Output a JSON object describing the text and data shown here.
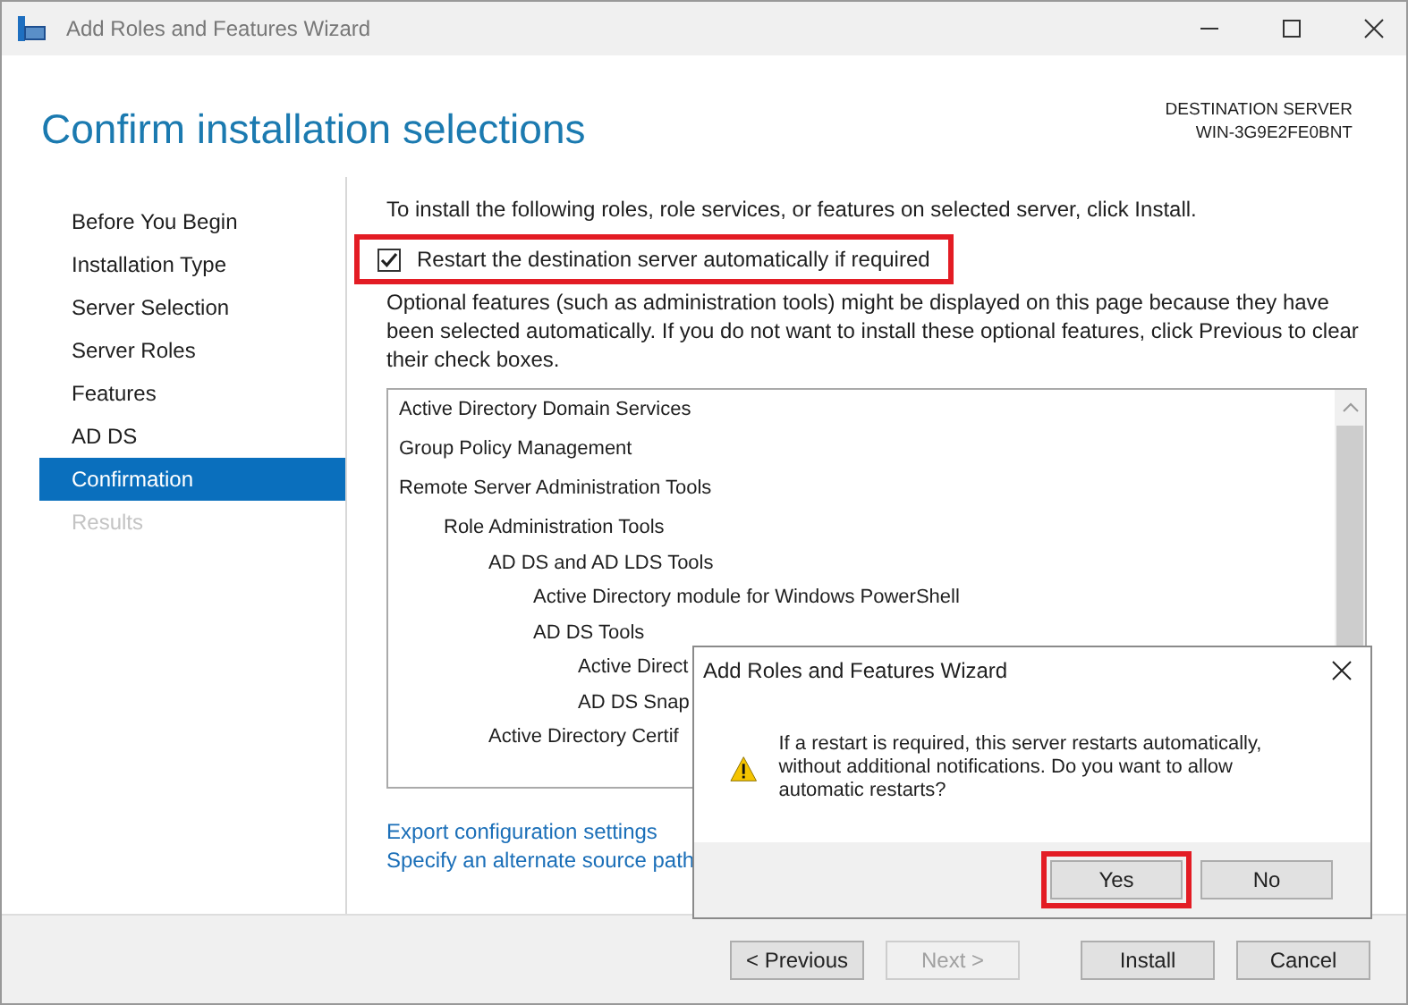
{
  "window": {
    "title": "Add Roles and Features Wizard"
  },
  "header": {
    "title": "Confirm installation selections",
    "server_label": "DESTINATION SERVER",
    "server_name": "WIN-3G9E2FE0BNT"
  },
  "sidebar": {
    "items": [
      {
        "label": "Before You Begin",
        "selected": false,
        "disabled": false
      },
      {
        "label": "Installation Type",
        "selected": false,
        "disabled": false
      },
      {
        "label": "Server Selection",
        "selected": false,
        "disabled": false
      },
      {
        "label": "Server Roles",
        "selected": false,
        "disabled": false
      },
      {
        "label": "Features",
        "selected": false,
        "disabled": false
      },
      {
        "label": "AD DS",
        "selected": false,
        "disabled": false
      },
      {
        "label": "Confirmation",
        "selected": true,
        "disabled": false
      },
      {
        "label": "Results",
        "selected": false,
        "disabled": true
      }
    ]
  },
  "intro": "To install the following roles, role services, or features on selected server, click Install.",
  "restart_option": {
    "label": "Restart the destination server automatically if required",
    "checked": true,
    "highlighted": true
  },
  "note": "Optional features (such as administration tools) might be displayed on this page because they have been selected automatically. If you do not want to install these optional features, click Previous to clear their check boxes.",
  "features": [
    {
      "label": "Active Directory Domain Services"
    },
    {
      "label": "Group Policy Management"
    },
    {
      "label": "Remote Server Administration Tools",
      "children": [
        {
          "label": "Role Administration Tools",
          "children": [
            {
              "label": "AD DS and AD LDS Tools",
              "children": [
                {
                  "label": "Active Directory module for Windows PowerShell"
                },
                {
                  "label": "AD DS Tools",
                  "children": [
                    {
                      "label": "Active Direct"
                    },
                    {
                      "label": "AD DS Snap"
                    }
                  ]
                }
              ]
            },
            {
              "label": "Active Directory Certif"
            }
          ]
        }
      ]
    }
  ],
  "links": [
    "Export configuration settings",
    "Specify an alternate source path"
  ],
  "buttons": [
    {
      "label": "< Previous",
      "disabled": false
    },
    {
      "label": "Next >",
      "disabled": true
    },
    {
      "label": "Install",
      "disabled": false
    },
    {
      "label": "Cancel",
      "disabled": false
    }
  ],
  "dialog": {
    "title": "Add Roles and Features Wizard",
    "message": "If a restart is required, this server restarts automatically, without additional notifications. Do you want to allow automatic restarts?",
    "buttons": [
      {
        "label": "Yes",
        "highlighted": true
      },
      {
        "label": "No",
        "highlighted": false
      }
    ]
  }
}
